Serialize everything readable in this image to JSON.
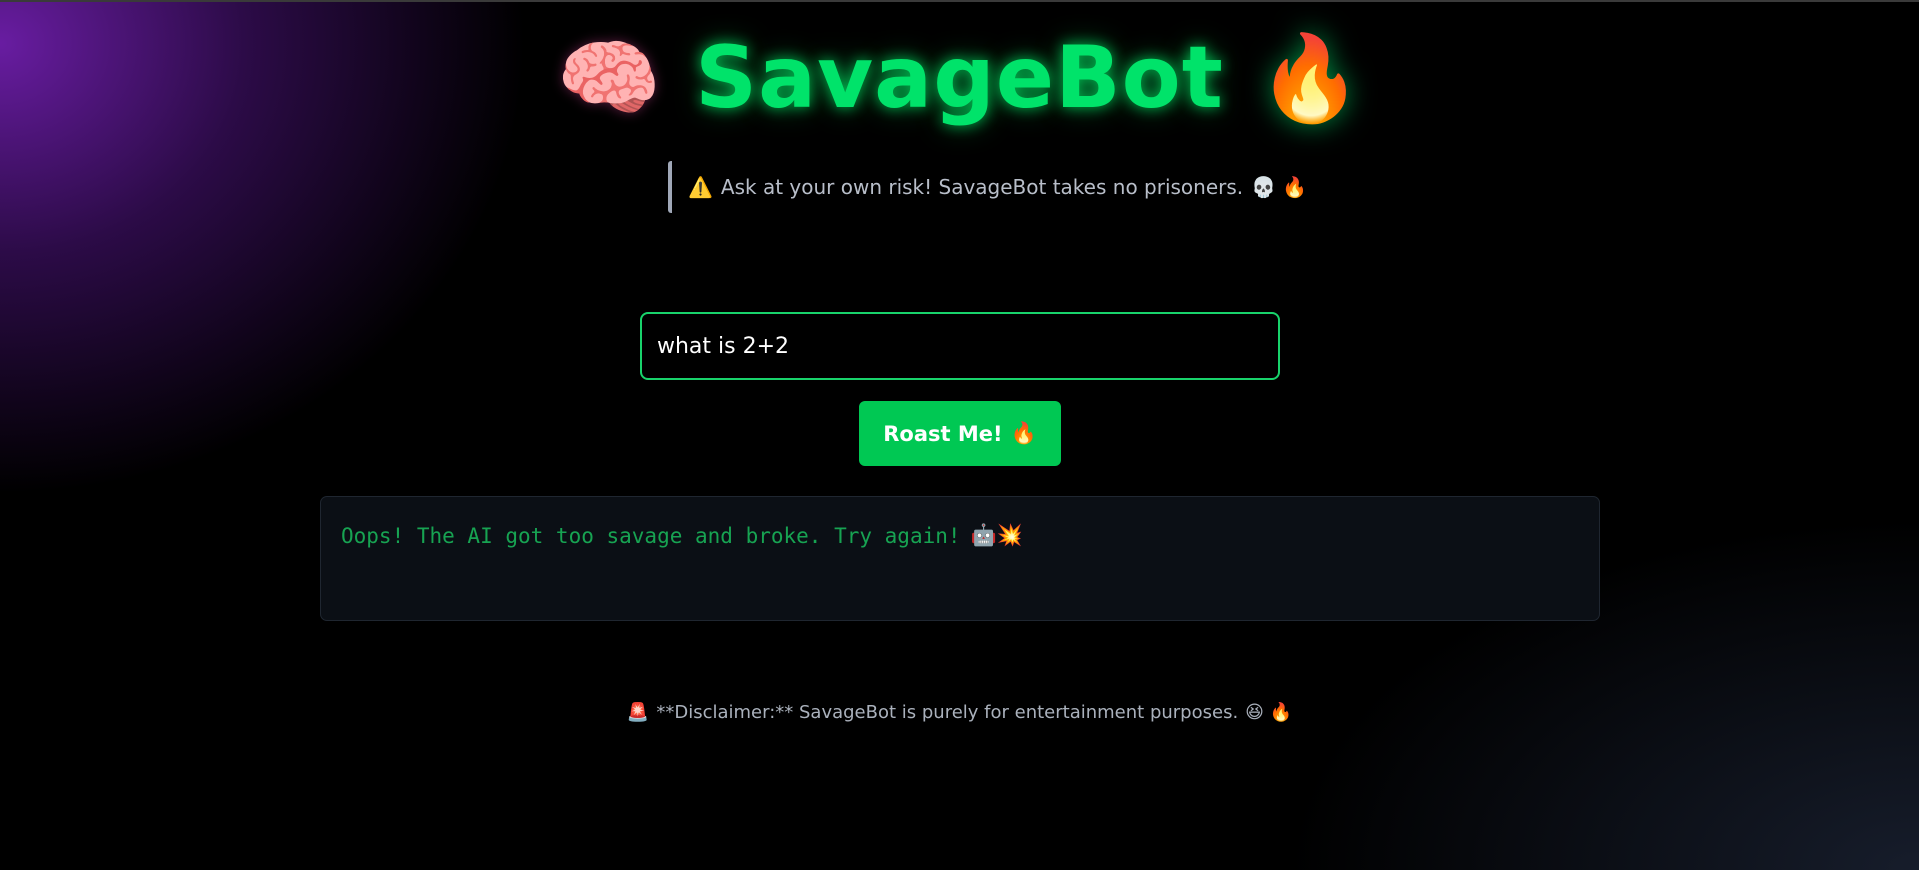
{
  "header": {
    "brain_emoji": "🧠",
    "title": "SavageBot",
    "fire_emoji": "🔥"
  },
  "warning": {
    "icon": "⚠️",
    "text": "Ask at your own risk! SavageBot takes no prisoners.",
    "trailing_emojis": "💀 🔥"
  },
  "input": {
    "value": "what is 2+2",
    "placeholder": ""
  },
  "roast_button": {
    "label": "Roast Me!",
    "emoji": "🔥"
  },
  "output": {
    "text": "Oops! The AI got too savage and broke. Try again!",
    "emojis": "🤖💥"
  },
  "disclaimer": {
    "icon": "🚨",
    "text": "**Disclaimer:** SavageBot is purely for entertainment purposes.",
    "trailing_emojis": "😆 🔥"
  },
  "colors": {
    "accent_green": "#00e36a",
    "button_green": "#00c853",
    "output_text": "#17a352",
    "background": "#000000",
    "purple_glow": "#6e1eaa"
  }
}
